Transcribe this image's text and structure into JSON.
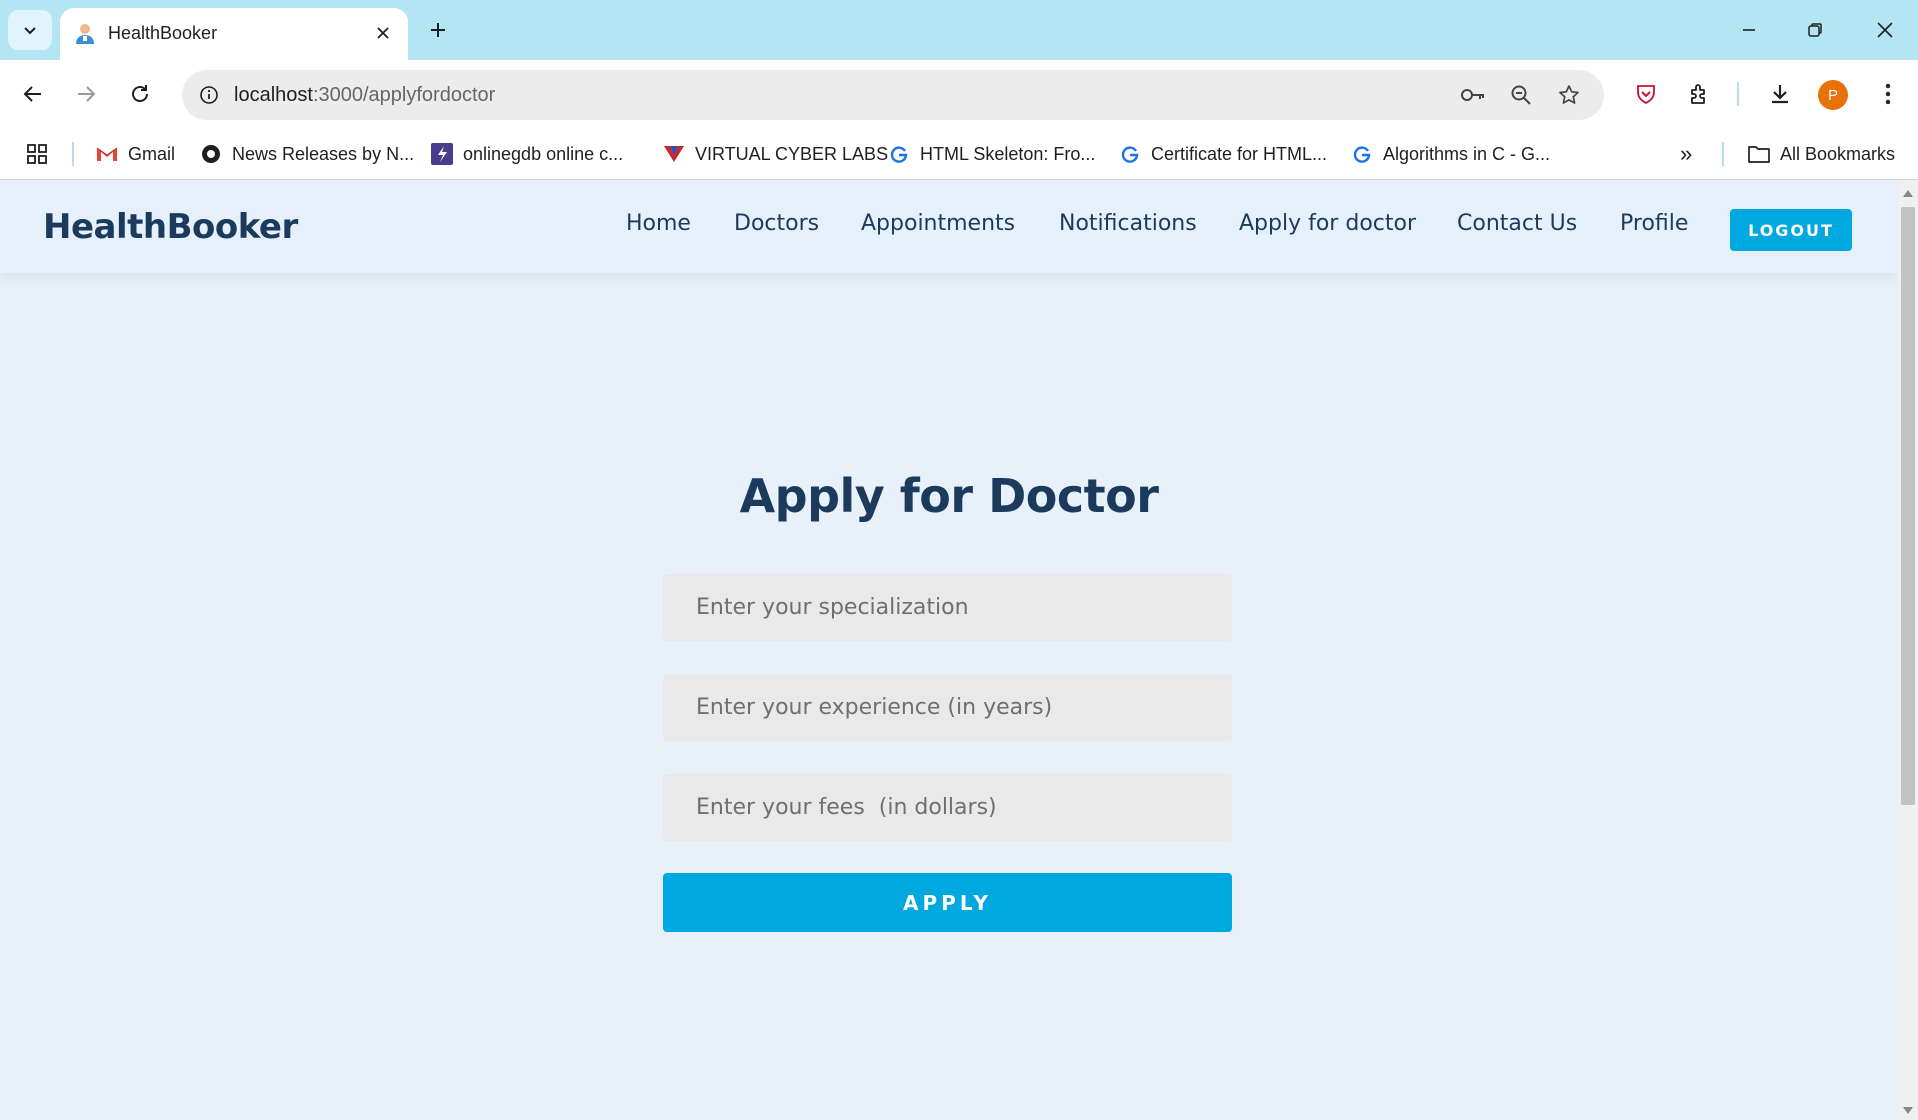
{
  "browser": {
    "tab_title": "HealthBooker",
    "url_host": "localhost",
    "url_path": ":3000/applyfordoctor",
    "profile_initial": "P",
    "bookmarks": [
      {
        "label": "Gmail",
        "icon": "gmail-icon"
      },
      {
        "label": "News Releases by N...",
        "icon": "news-icon"
      },
      {
        "label": "onlinegdb online c...",
        "icon": "onlinegdb-icon"
      },
      {
        "label": "VIRTUAL CYBER LABS",
        "icon": "cyber-labs-icon"
      },
      {
        "label": "HTML Skeleton: Fro...",
        "icon": "g-icon"
      },
      {
        "label": "Certificate for HTML...",
        "icon": "g-icon"
      },
      {
        "label": "Algorithms in C - G...",
        "icon": "g-icon"
      }
    ],
    "overflow_label": "»",
    "all_bookmarks": "All Bookmarks"
  },
  "site": {
    "logo": "HealthBooker",
    "nav": [
      "Home",
      "Doctors",
      "Appointments",
      "Notifications",
      "Apply for doctor",
      "Contact Us",
      "Profile"
    ],
    "logout_label": "LOGOUT"
  },
  "form": {
    "title": "Apply for Doctor",
    "specialization_placeholder": "Enter your specialization",
    "experience_placeholder": "Enter your experience (in years)",
    "fees_placeholder": "Enter your fees  (in dollars)",
    "submit_label": "APPLY"
  },
  "colors": {
    "tabstrip": "#b3e5f3",
    "page_bg": "#e8f1f9",
    "brand_text": "#1b3a5c",
    "accent": "#00a8e0"
  }
}
